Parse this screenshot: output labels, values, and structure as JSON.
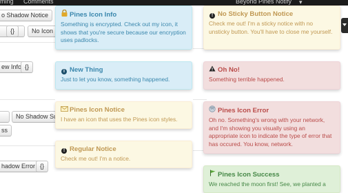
{
  "navbar": {
    "item1": "ming",
    "item2": "Comments",
    "item3": "Beyond Pines Notify"
  },
  "buttons": {
    "no_shadow_notice": "o Shadow Notice",
    "braces1": "{}",
    "no_icon": "No Icon",
    "ew_info": "ew Info",
    "braces2": "{}",
    "no_shadow_su": "No Shadow Su",
    "ss": "ss",
    "hadow_error": "hadow Error",
    "braces3": "{}"
  },
  "notices": {
    "pines_icon_info": {
      "title": "Pines Icon Info",
      "text": "Something is encrypted. Check out my icon, it shows that you're secure because our encryption uses padlocks.",
      "icon": "padlock-icon"
    },
    "new_thing": {
      "title": "New Thing",
      "text": "Just to let you know, something happened.",
      "icon": "info-circle-icon"
    },
    "pines_icon_notice": {
      "title": "Pines Icon Notice",
      "text": "I have an icon that uses the Pines icon styles.",
      "icon": "envelope-icon"
    },
    "regular_notice": {
      "title": "Regular Notice",
      "text": "Check me out! I'm a notice.",
      "icon": "exclamation-circle-icon"
    },
    "no_sticky": {
      "title": "No Sticky Button Notice",
      "text": "Check me out! I'm a sticky notice with no unsticky button. You'll have to close me yourself.",
      "icon": "exclamation-circle-icon"
    },
    "oh_no": {
      "title": "Oh No!",
      "text": "Something terrible happened.",
      "icon": "warning-triangle-icon"
    },
    "pines_icon_error": {
      "title": "Pines Icon Error",
      "text": "Oh no. Something's wrong with your network, and I'm showing you visually using an appropriate icon to indicate the type of error that has occured. You know, network.",
      "icon": "network-icon"
    },
    "pines_icon_success": {
      "title": "Pines Icon Success",
      "text": "We reached the moon first! See, we planted a",
      "icon": "flag-icon"
    }
  },
  "colors": {
    "info": "#3a87ad",
    "notice": "#c09853",
    "error": "#b94a48",
    "success": "#468847"
  }
}
